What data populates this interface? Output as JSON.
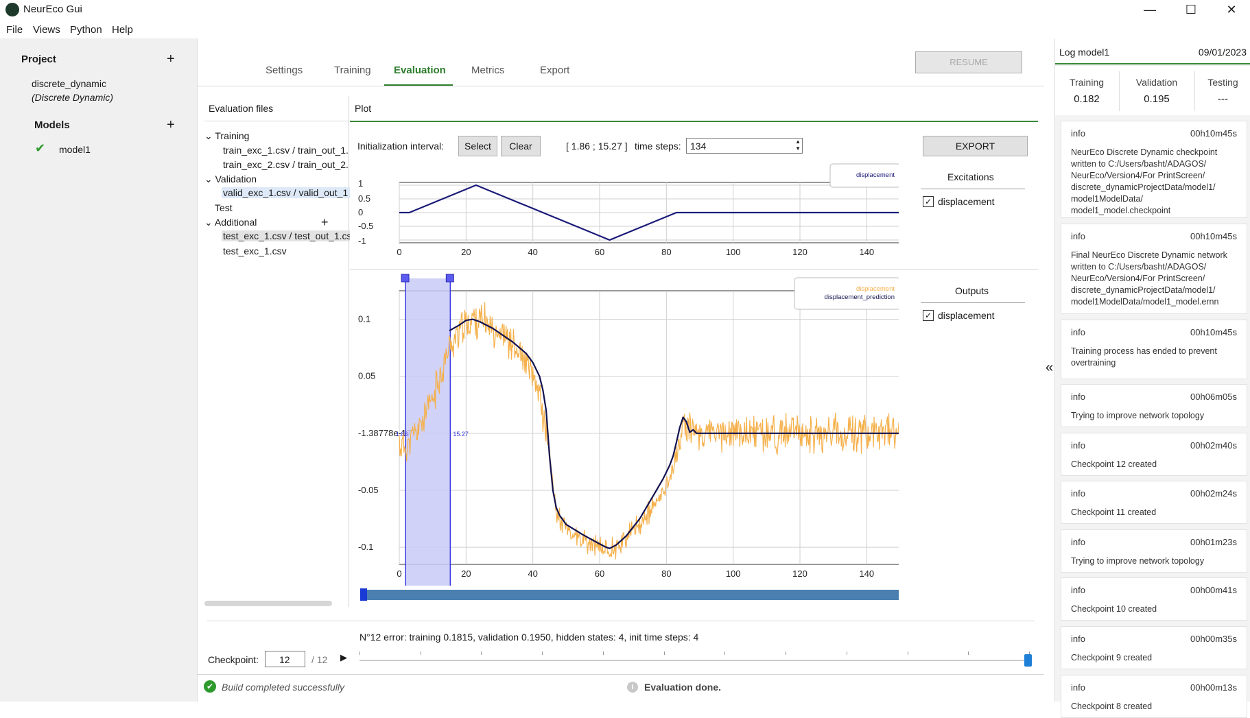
{
  "window": {
    "title": "NeurEco Gui",
    "minimize": "—",
    "maximize": "☐",
    "close": "✕"
  },
  "menu": [
    "File",
    "Views",
    "Python",
    "Help"
  ],
  "project": {
    "header": "Project",
    "name": "discrete_dynamic",
    "type": "(Discrete Dynamic)",
    "models_header": "Models",
    "model_name": "model1"
  },
  "tabs": [
    "Settings",
    "Training",
    "Evaluation",
    "Metrics",
    "Export"
  ],
  "active_tab": "Evaluation",
  "resume_label": "RESUME",
  "eval_files": {
    "header": "Evaluation files",
    "training_label": "Training",
    "training_files": [
      "train_exc_1.csv / train_out_1.",
      "train_exc_2.csv / train_out_2."
    ],
    "validation_label": "Validation",
    "validation_files": [
      "valid_exc_1.csv / valid_out_1"
    ],
    "test_label": "Test",
    "additional_label": "Additional",
    "additional_files": [
      "test_exc_1.csv / test_out_1.cs",
      "test_exc_1.csv"
    ]
  },
  "plot": {
    "header": "Plot",
    "init_label": "Initialization interval:",
    "select_label": "Select",
    "clear_label": "Clear",
    "interval_text": "[ 1.86 ; 15.27 ]",
    "timesteps_label": "time steps:",
    "timesteps_value": "134",
    "export_label": "EXPORT",
    "excitations_header": "Excitations",
    "excitation_item": "displacement",
    "outputs_header": "Outputs",
    "output_item": "displacement",
    "sel_start_label": "1.86",
    "sel_end_label": "15.27"
  },
  "chart_data": [
    {
      "type": "line",
      "title": "",
      "series": [
        {
          "name": "displacement",
          "x": [
            0,
            3,
            23,
            63,
            83,
            150
          ],
          "y": [
            0,
            0,
            1,
            -1,
            0,
            0
          ],
          "color": "#1a1a7a"
        }
      ],
      "xlim": [
        0,
        150
      ],
      "ylim": [
        -1.1,
        1.1
      ],
      "xticks": [
        0,
        20,
        40,
        60,
        80,
        100,
        120,
        140
      ],
      "yticks": [
        1,
        0.5,
        0,
        -0.5,
        -1
      ],
      "ytick_labels": [
        "1",
        "0.5",
        "0",
        "-0.5",
        "-1"
      ],
      "grid": true,
      "legend": "top-right"
    },
    {
      "type": "line",
      "title": "",
      "series": [
        {
          "name": "displacement",
          "color": "#f5b04a",
          "noisy": true,
          "x": [
            0,
            2,
            5,
            10,
            15,
            18,
            22,
            26,
            32,
            38,
            42,
            44,
            46,
            47,
            48,
            50,
            55,
            60,
            63,
            66,
            72,
            78,
            82,
            84,
            85,
            87,
            90,
            100,
            110,
            120,
            130,
            150
          ],
          "y": [
            -0.01,
            -0.012,
            0.0,
            0.03,
            0.075,
            0.09,
            0.1,
            0.097,
            0.085,
            0.06,
            0.035,
            0.0,
            -0.04,
            -0.07,
            -0.075,
            -0.085,
            -0.095,
            -0.1,
            -0.102,
            -0.097,
            -0.08,
            -0.058,
            -0.03,
            -0.01,
            0.012,
            0.004,
            0.0,
            0.0,
            0.0,
            0.0,
            0.0,
            0.0
          ]
        },
        {
          "name": "displacement_prediction",
          "color": "#12124f",
          "x": [
            15,
            18,
            20,
            22,
            24,
            26,
            28,
            30,
            34,
            38,
            40,
            42,
            43,
            44,
            45,
            46,
            47,
            48,
            50,
            55,
            60,
            62,
            63,
            65,
            68,
            72,
            76,
            79,
            81,
            82,
            83,
            84,
            85,
            86,
            87,
            88,
            89,
            90,
            92,
            95,
            100,
            110,
            120,
            130,
            150
          ],
          "y": [
            0.09,
            0.095,
            0.099,
            0.1,
            0.098,
            0.095,
            0.092,
            0.088,
            0.08,
            0.07,
            0.062,
            0.05,
            0.038,
            0.02,
            -0.02,
            -0.05,
            -0.065,
            -0.072,
            -0.08,
            -0.089,
            -0.097,
            -0.1,
            -0.101,
            -0.098,
            -0.09,
            -0.075,
            -0.055,
            -0.04,
            -0.028,
            -0.02,
            -0.008,
            0.005,
            0.014,
            0.01,
            0.001,
            0.003,
            0.0,
            0.0,
            0.0,
            0.0,
            0.0,
            0.0,
            0.0,
            0.0,
            0.0
          ]
        }
      ],
      "xlim": [
        0,
        150
      ],
      "ylim": [
        -0.115,
        0.125
      ],
      "xticks": [
        0,
        20,
        40,
        60,
        80,
        100,
        120,
        140
      ],
      "yticks": [
        0.1,
        0.05,
        0,
        -0.05,
        -0.1
      ],
      "ytick_labels": [
        "0.1",
        "0.05",
        "-1.38778e-17",
        "-0.05",
        "-0.1"
      ],
      "init_interval": [
        1.86,
        15.27
      ],
      "grid": true,
      "legend": "top-right"
    }
  ],
  "checkpoint": {
    "error_text": "N°12 error: training 0.1815, validation 0.1950, hidden states: 4, init time steps: 4",
    "label": "Checkpoint:",
    "value": "12",
    "total": "/ 12"
  },
  "status": {
    "build": "Build completed successfully",
    "evaluation": "Evaluation done."
  },
  "log": {
    "title": "Log model1",
    "date": "09/01/2023",
    "metrics": [
      {
        "label": "Training",
        "value": "0.182"
      },
      {
        "label": "Validation",
        "value": "0.195"
      },
      {
        "label": "Testing",
        "value": "---"
      }
    ],
    "entries": [
      {
        "level": "info",
        "time": "00h10m45s",
        "message": "NeurEco Discrete Dynamic checkpoint written to C:/Users/basht/ADAGOS/ NeurEco/Version4/For PrintScreen/ discrete_dynamicProjectData/model1/ model1ModelData/ model1_model.checkpoint"
      },
      {
        "level": "info",
        "time": "00h10m45s",
        "message": "Final NeurEco Discrete Dynamic network written to C:/Users/basht/ADAGOS/ NeurEco/Version4/For PrintScreen/ discrete_dynamicProjectData/model1/ model1ModelData/model1_model.ernn"
      },
      {
        "level": "info",
        "time": "00h10m45s",
        "message": "Training process has ended to prevent overtraining"
      },
      {
        "level": "info",
        "time": "00h06m05s",
        "message": "Trying to improve network topology"
      },
      {
        "level": "info",
        "time": "00h02m40s",
        "message": "Checkpoint 12 created"
      },
      {
        "level": "info",
        "time": "00h02m24s",
        "message": "Checkpoint 11 created"
      },
      {
        "level": "info",
        "time": "00h01m23s",
        "message": "Trying to improve network topology"
      },
      {
        "level": "info",
        "time": "00h00m41s",
        "message": "Checkpoint 10 created"
      },
      {
        "level": "info",
        "time": "00h00m35s",
        "message": "Checkpoint 9 created"
      },
      {
        "level": "info",
        "time": "00h00m13s",
        "message": "Checkpoint 8 created"
      }
    ]
  },
  "colors": {
    "accent": "#2d7d2d",
    "excitation": "#1a1a7a",
    "measured": "#f5b04a",
    "prediction": "#12124f",
    "selection": "#c9caf7",
    "slider": "#4a7fb0"
  }
}
